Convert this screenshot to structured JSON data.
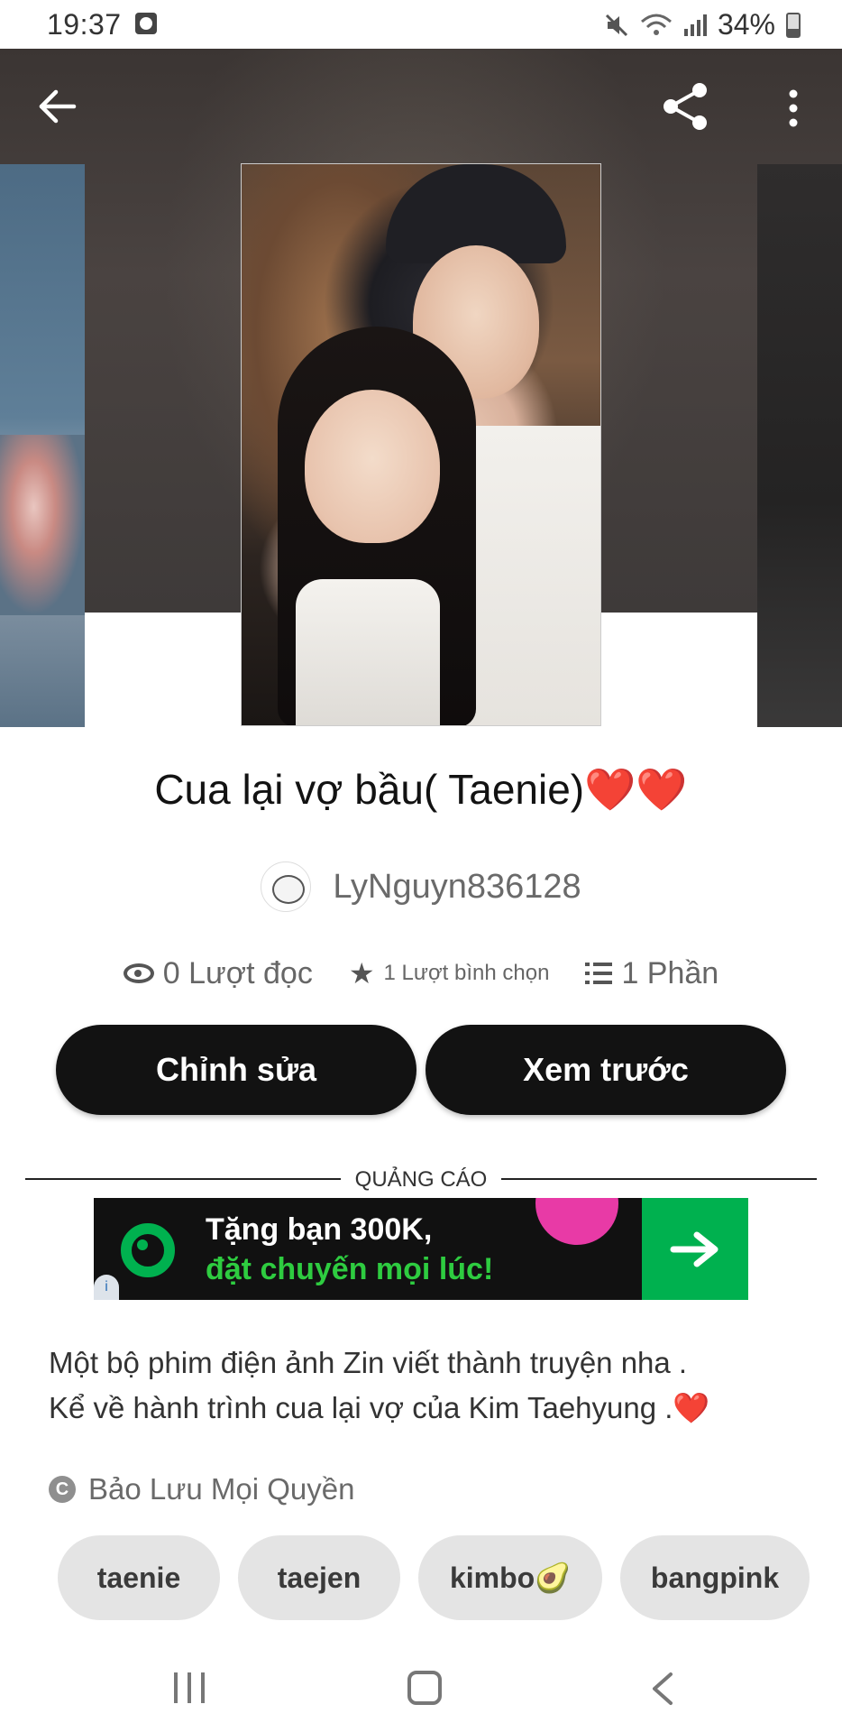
{
  "status_bar": {
    "time": "19:37",
    "battery": "34%",
    "icons": [
      "alarm-icon",
      "mute-icon",
      "wifi-icon",
      "signal-icon",
      "battery-icon"
    ]
  },
  "header": {
    "icons": [
      "back-arrow-icon",
      "share-icon",
      "more-vert-icon"
    ]
  },
  "story": {
    "title": "Cua lại vợ bầu( Taenie)❤️❤️",
    "author": "LyNguyn836128",
    "stats": {
      "reads": "0 Lượt đọc",
      "votes": "1 Lượt bình chọn",
      "parts": "1 Phần"
    },
    "buttons": {
      "edit": "Chỉnh sửa",
      "preview": "Xem trước"
    },
    "description_lines": [
      "Một bộ phim điện ảnh Zin viết thành truyện nha .",
      "Kể về hành trình cua lại vợ của Kim Taehyung .❤️"
    ],
    "copyright": "Bảo Lưu Mọi Quyền",
    "tags": [
      "taenie",
      "taejen",
      "kimbo🥑",
      "bangpink"
    ]
  },
  "ad": {
    "label": "QUẢNG CÁO",
    "line1": "Tặng bạn 300K,",
    "line2": "đặt chuyến mọi lúc!",
    "colors": {
      "brand_green": "#00b14f",
      "accent_pink": "#e83aa6"
    }
  },
  "nav": {
    "icons": [
      "recents-icon",
      "home-icon",
      "back-icon"
    ]
  }
}
